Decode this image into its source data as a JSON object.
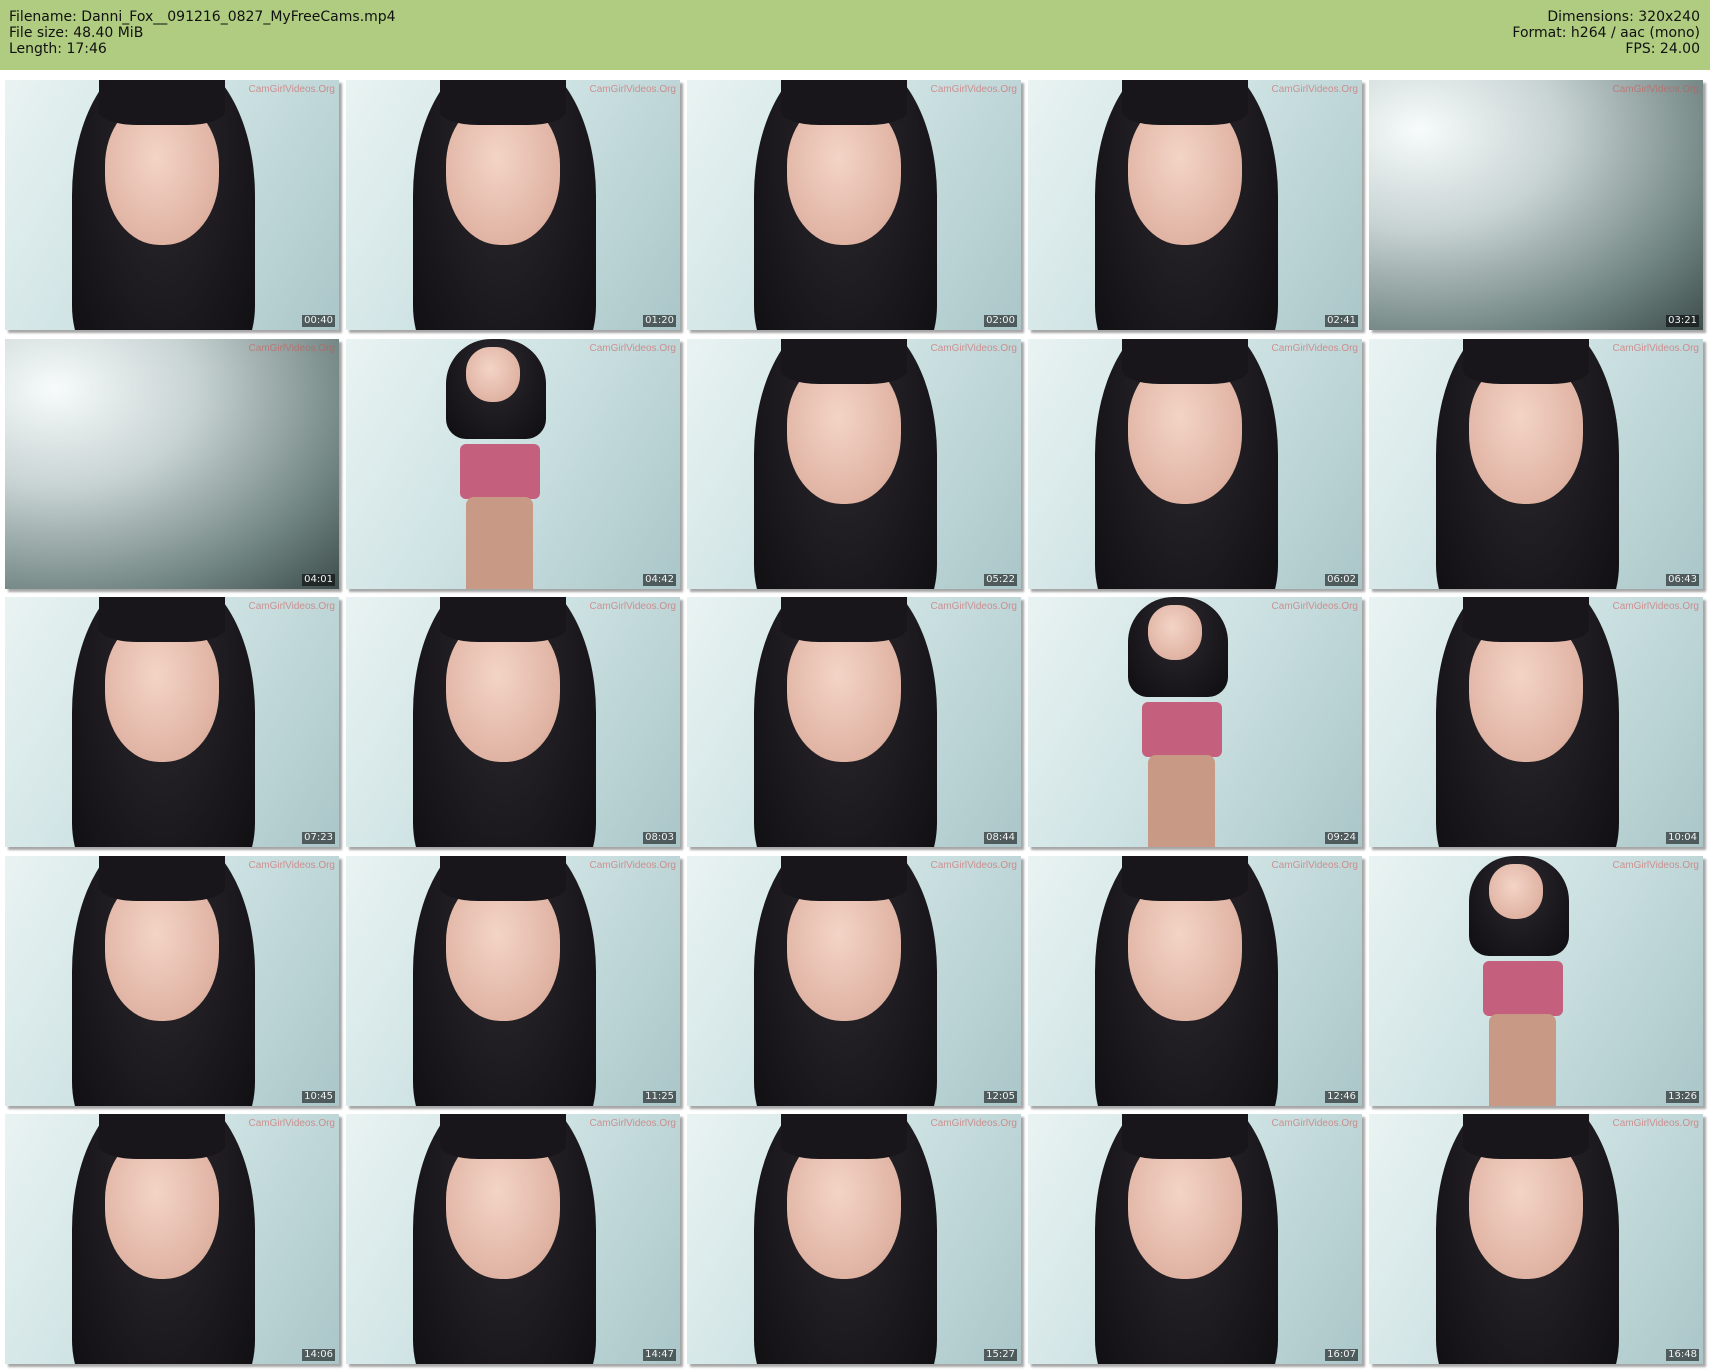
{
  "header": {
    "filename_label": "Filename: Danni_Fox__091216_0827_MyFreeCams.mp4",
    "filesize_label": "File size: 48.40 MiB",
    "length_label": "Length: 17:46",
    "dimensions_label": "Dimensions: 320x240",
    "format_label": "Format: h264 / aac (mono)",
    "fps_label": "FPS: 24.00"
  },
  "colors": {
    "header_bg": "#b0cc80",
    "watermark": "#d25050"
  },
  "watermark_text": "CamGirlVideos.Org",
  "thumbnails": [
    {
      "timestamp": "00:40",
      "kind": "face"
    },
    {
      "timestamp": "01:20",
      "kind": "face"
    },
    {
      "timestamp": "02:00",
      "kind": "face"
    },
    {
      "timestamp": "02:41",
      "kind": "face"
    },
    {
      "timestamp": "03:21",
      "kind": "blank"
    },
    {
      "timestamp": "04:01",
      "kind": "blank"
    },
    {
      "timestamp": "04:42",
      "kind": "body"
    },
    {
      "timestamp": "05:22",
      "kind": "face"
    },
    {
      "timestamp": "06:02",
      "kind": "face"
    },
    {
      "timestamp": "06:43",
      "kind": "face"
    },
    {
      "timestamp": "07:23",
      "kind": "face"
    },
    {
      "timestamp": "08:03",
      "kind": "face"
    },
    {
      "timestamp": "08:44",
      "kind": "face"
    },
    {
      "timestamp": "09:24",
      "kind": "body"
    },
    {
      "timestamp": "10:04",
      "kind": "face"
    },
    {
      "timestamp": "10:45",
      "kind": "face"
    },
    {
      "timestamp": "11:25",
      "kind": "face"
    },
    {
      "timestamp": "12:05",
      "kind": "face"
    },
    {
      "timestamp": "12:46",
      "kind": "face"
    },
    {
      "timestamp": "13:26",
      "kind": "body"
    },
    {
      "timestamp": "14:06",
      "kind": "face"
    },
    {
      "timestamp": "14:47",
      "kind": "face"
    },
    {
      "timestamp": "15:27",
      "kind": "face"
    },
    {
      "timestamp": "16:07",
      "kind": "face"
    },
    {
      "timestamp": "16:48",
      "kind": "face"
    }
  ]
}
